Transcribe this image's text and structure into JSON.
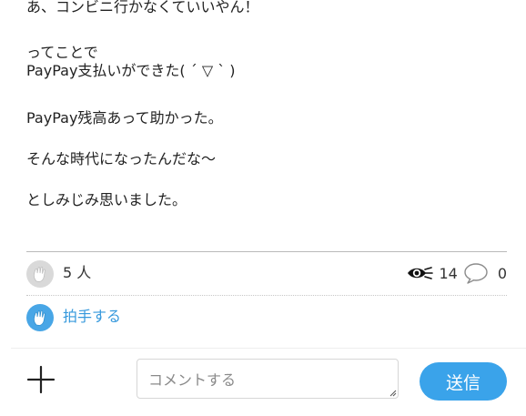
{
  "post": {
    "paragraphs": [
      "あ、コンビニ行かなくていいやん！",
      "ってことで",
      "PayPay支払いができた( ´ ▽ ` )",
      "PayPay残高あって助かった。",
      "そんな時代になったんだな〜",
      "としみじみ思いました。"
    ]
  },
  "stats": {
    "clap_count": "5 人",
    "views": "14",
    "comments": "0",
    "clap_icon": "clap-hands-icon",
    "views_icon": "eye-icon",
    "comments_icon": "speech-bubble-icon"
  },
  "applause": {
    "label": "拍手する",
    "icon": "clap-hands-icon"
  },
  "composer": {
    "add_icon": "plus-icon",
    "placeholder": "コメントする",
    "send_label": "送信"
  },
  "colors": {
    "accent": "#3aa3ea",
    "link": "#3598dc",
    "clap_gray": "#d9d9d9"
  }
}
